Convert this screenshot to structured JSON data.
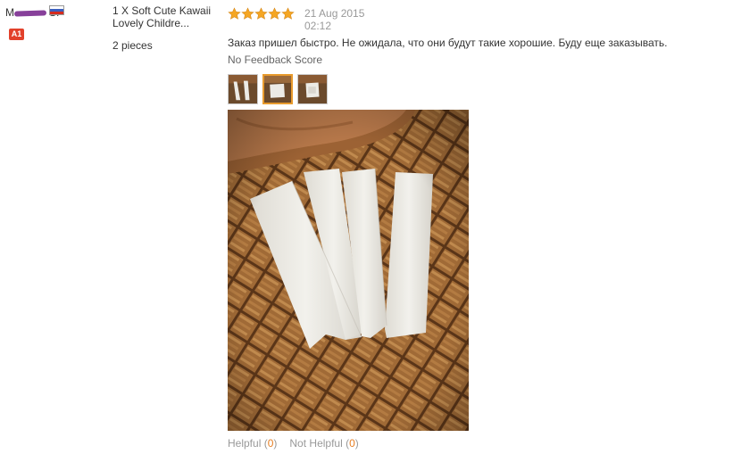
{
  "buyer": {
    "name_prefix": "M",
    "name_suffix": "S.",
    "country_flag_icon": "russia-flag-icon",
    "level_badge": "A1"
  },
  "product": {
    "title": "1 X Soft Cute Kawaii Lovely Childre...",
    "quantity": "2 pieces"
  },
  "feedback": {
    "rating": 5,
    "rating_max": 5,
    "date": "21 Aug 2015",
    "time": "02:12",
    "comment": "Заказ пришел быстро. Не ожидала, что они будут такие хорошие. Буду еще заказывать.",
    "score_text": "No Feedback Score",
    "thumbnail_count": 3,
    "active_thumbnail_index": 1
  },
  "helpful": {
    "helpful_label": "Helpful",
    "helpful_count": "0",
    "not_helpful_label": "Not Helpful",
    "not_helpful_count": "0"
  },
  "colors": {
    "star": "#f5a623",
    "badge": "#e2412b",
    "count": "#e67e22",
    "muted": "#999999"
  }
}
